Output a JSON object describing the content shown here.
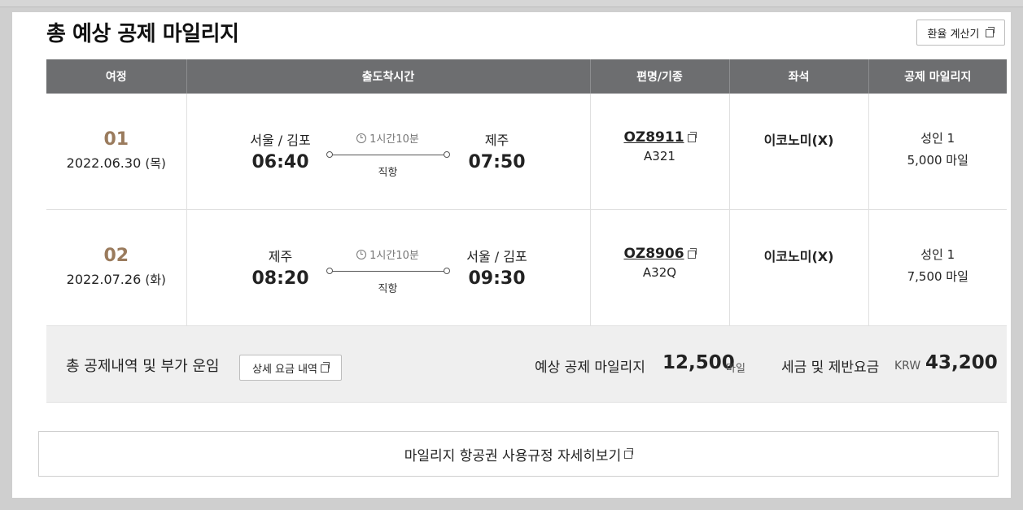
{
  "page_title": "총 예상 공제 마일리지",
  "exchange_calc_button": "환율 계산기",
  "table": {
    "headers": [
      "여정",
      "출도착시간",
      "편명/기종",
      "좌석",
      "공제 마일리지"
    ],
    "rows": [
      {
        "segment": "01",
        "date": "2022.06.30",
        "weekday": "(목)",
        "dep_city": "서울 / 김포",
        "dep_time": "06:40",
        "duration": "1시간10분",
        "route_type": "직항",
        "arr_city": "제주",
        "arr_time": "07:50",
        "flight_no": "OZ8911",
        "aircraft": "A321",
        "seat_class": "이코노미(X)",
        "passenger": "성인 1",
        "miles": "5,000 마일"
      },
      {
        "segment": "02",
        "date": "2022.07.26",
        "weekday": "(화)",
        "dep_city": "제주",
        "dep_time": "08:20",
        "duration": "1시간10분",
        "route_type": "직항",
        "arr_city": "서울 / 김포",
        "arr_time": "09:30",
        "flight_no": "OZ8906",
        "aircraft": "A32Q",
        "seat_class": "이코노미(X)",
        "passenger": "성인 1",
        "miles": "7,500 마일"
      }
    ]
  },
  "summary": {
    "label": "총 공제내역 및 부가 운임",
    "detail_button": "상세 요금 내역",
    "estimated_label": "예상 공제 마일리지",
    "estimated_value": "12,500",
    "estimated_unit": "마일",
    "tax_label": "세금 및 제반요금",
    "tax_currency": "KRW",
    "tax_value": "43,200"
  },
  "rules_button": "마일리지 항공권 사용규정 자세히보기",
  "colors": {
    "header_bg": "#6d6e70",
    "segment_number": "#9a7b5d",
    "summary_bg": "#efefef"
  },
  "icons": {
    "external_link": "external-link-icon",
    "clock": "clock-icon"
  }
}
